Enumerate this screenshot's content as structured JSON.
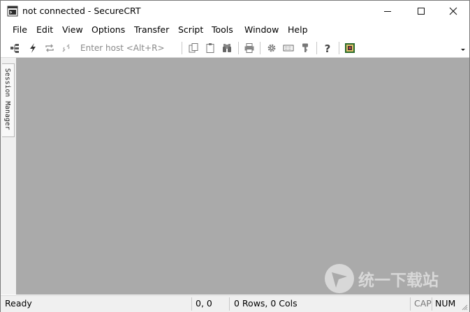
{
  "window": {
    "title": "not connected - SecureCRT"
  },
  "menu": [
    "File",
    "Edit",
    "View",
    "Options",
    "Transfer",
    "Script",
    "Tools",
    "Window",
    "Help"
  ],
  "toolbar": {
    "host_placeholder": "Enter host <Alt+R>",
    "icons": [
      "connect-in-tab-icon",
      "quick-connect-icon",
      "reconnect-icon",
      "disconnect-icon",
      "copy-icon",
      "paste-icon",
      "find-icon",
      "print-icon",
      "session-options-icon",
      "keymap-icon",
      "key-icon",
      "help-icon",
      "sftp-icon"
    ]
  },
  "session_manager": {
    "label": "Session Manager"
  },
  "status": {
    "ready": "Ready",
    "position": "0, 0",
    "size": "0 Rows, 0 Cols",
    "cap": "CAP",
    "num": "NUM"
  },
  "watermark": {
    "text": "统一下载站"
  }
}
